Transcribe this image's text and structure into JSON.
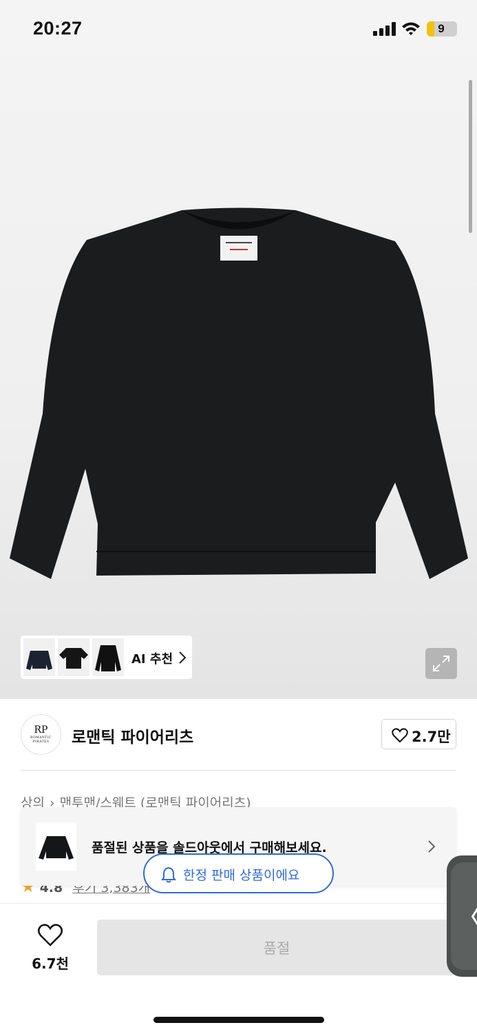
{
  "status_bar": {
    "time": "20:27",
    "battery": "9"
  },
  "product": {
    "image_icon": "black-crewneck-sweatshirt",
    "ai_recommend": {
      "label": "AI 추천",
      "chevron_icon": "chevron-right-icon"
    },
    "expand_icon": "expand-icon"
  },
  "brand": {
    "logo_text": "RP",
    "logo_sub": "ROMANTIC PIRATES",
    "name": "로맨틱 파이어리츠",
    "likes": "2.7만"
  },
  "breadcrumb": {
    "items": [
      "상의",
      "맨투맨/스웨트 (로맨틱 파이어리츠)"
    ],
    "separator": "›"
  },
  "rating": {
    "star": "★",
    "score": "4.8",
    "reviews": "후기 3,383개"
  },
  "soldout_banner": {
    "text": "품절된 상품을 솔드아웃에서 구매해보세요."
  },
  "limited_pill": {
    "text": "한정 판매 상품이에요"
  },
  "bottom_bar": {
    "wish_count": "6.7천",
    "buy_label": "품절"
  },
  "side_tab": {
    "label": "〈"
  },
  "colors": {
    "accent_blue": "#2f6bd6",
    "star": "#f6a623",
    "battery": "#f2c20a"
  }
}
